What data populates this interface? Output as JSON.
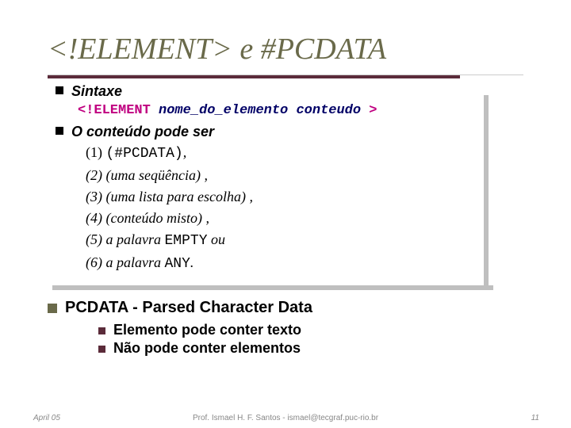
{
  "title": "<!ELEMENT> e #PCDATA",
  "syntax": {
    "label": "Sintaxe",
    "kw_open": "<!ELEMENT",
    "arg1": "nome_do_elemento",
    "arg2": "conteudo",
    "kw_close": ">"
  },
  "content_header_prefix": "O ",
  "content_header_bold": "conteúdo",
  "content_header_suffix": " pode ser",
  "items": {
    "i1_num": "(1) ",
    "i1_code": "(#PCDATA)",
    "i1_tail": ",",
    "i2": "(2) (uma seqüência) ,",
    "i3": "(3) (uma lista para escolha) ,",
    "i4": "(4) (conteúdo misto) ,",
    "i5_pre": "(5) a palavra ",
    "i5_code": "EMPTY",
    "i5_post": " ou",
    "i6_pre": "(6) a palavra ",
    "i6_code": "ANY",
    "i6_post": "."
  },
  "main_bullet": "PCDATA - Parsed Character Data",
  "sub1": "Elemento pode conter texto",
  "sub2": "Não pode conter elementos",
  "footer": {
    "date": "April 05",
    "prof": "Prof. Ismael H. F. Santos - ismael@tecgraf.puc-rio.br",
    "page": "11"
  }
}
